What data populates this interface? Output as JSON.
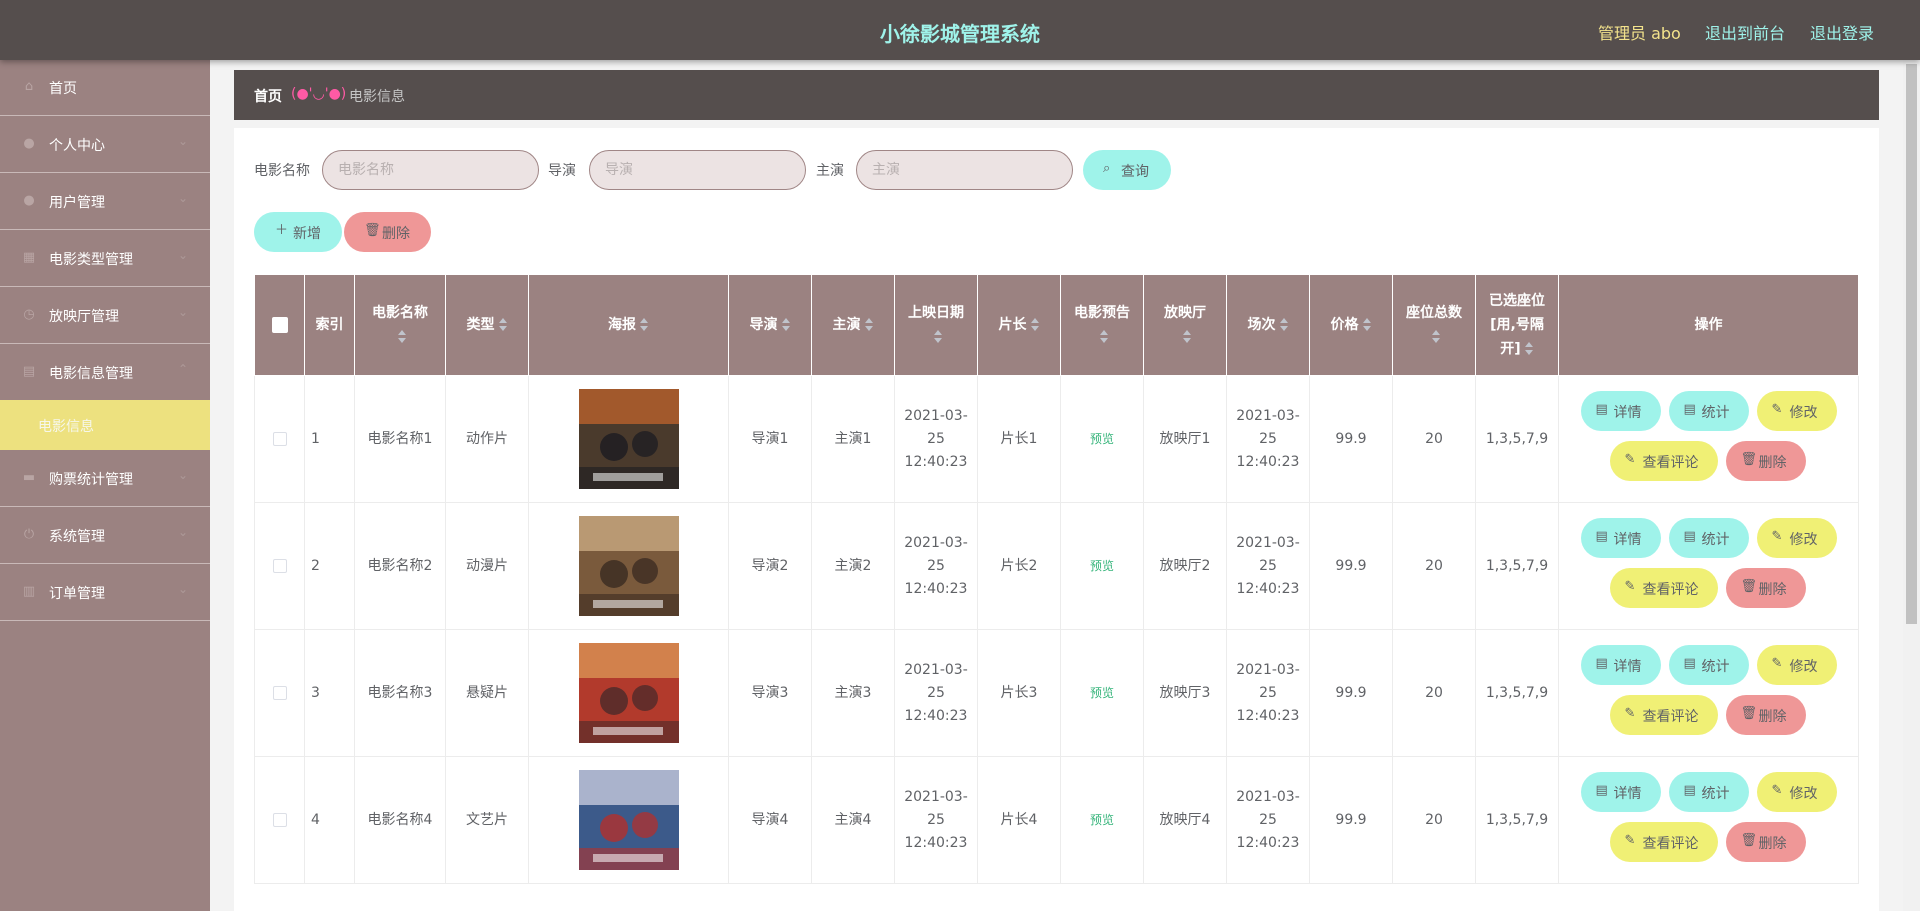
{
  "header": {
    "title": "小徐影城管理系统",
    "user": "管理员 abo",
    "to_front": "退出到前台",
    "logout": "退出登录"
  },
  "sidebar": {
    "items": [
      {
        "label": "首页",
        "icon": "home-icon"
      },
      {
        "label": "个人中心",
        "icon": "user-icon"
      },
      {
        "label": "用户管理",
        "icon": "user-icon"
      },
      {
        "label": "电影类型管理",
        "icon": "grid-icon"
      },
      {
        "label": "放映厅管理",
        "icon": "clock-icon"
      },
      {
        "label": "电影信息管理",
        "icon": "document-icon"
      },
      {
        "label": "购票统计管理",
        "icon": "briefcase-icon"
      },
      {
        "label": "系统管理",
        "icon": "power-icon"
      },
      {
        "label": "订单管理",
        "icon": "bar-chart-icon"
      }
    ],
    "active_sub": "电影信息"
  },
  "breadcrumb": {
    "home": "首页",
    "separator": "(●'◡'●)",
    "current": "电影信息"
  },
  "search": {
    "name_label": "电影名称",
    "name_placeholder": "电影名称",
    "director_label": "导演",
    "director_placeholder": "导演",
    "actor_label": "主演",
    "actor_placeholder": "主演",
    "query_button": "查询"
  },
  "actions": {
    "add": "新增",
    "delete": "删除"
  },
  "table": {
    "columns": [
      "索引",
      "电影名称",
      "类型",
      "海报",
      "导演",
      "主演",
      "上映日期",
      "片长",
      "电影预告",
      "放映厅",
      "场次",
      "价格",
      "座位总数",
      "已选座位[用,号隔开]",
      "操作"
    ],
    "row_buttons": {
      "detail": "详情",
      "stats": "统计",
      "edit": "修改",
      "comments": "查看评论",
      "delete": "删除"
    },
    "rows": [
      {
        "index": "1",
        "name": "电影名称1",
        "type": "动作片",
        "director": "导演1",
        "actor": "主演1",
        "release": "2021-03-25 12:40:23",
        "length": "片长1",
        "trailer": "预览",
        "hall": "放映厅1",
        "session": "2021-03-25 12:40:23",
        "price": "99.9",
        "seats": "20",
        "selected": "1,3,5,7,9"
      },
      {
        "index": "2",
        "name": "电影名称2",
        "type": "动漫片",
        "director": "导演2",
        "actor": "主演2",
        "release": "2021-03-25 12:40:23",
        "length": "片长2",
        "trailer": "预览",
        "hall": "放映厅2",
        "session": "2021-03-25 12:40:23",
        "price": "99.9",
        "seats": "20",
        "selected": "1,3,5,7,9"
      },
      {
        "index": "3",
        "name": "电影名称3",
        "type": "悬疑片",
        "director": "导演3",
        "actor": "主演3",
        "release": "2021-03-25 12:40:23",
        "length": "片长3",
        "trailer": "预览",
        "hall": "放映厅3",
        "session": "2021-03-25 12:40:23",
        "price": "99.9",
        "seats": "20",
        "selected": "1,3,5,7,9"
      },
      {
        "index": "4",
        "name": "电影名称4",
        "type": "文艺片",
        "director": "导演4",
        "actor": "主演4",
        "release": "2021-03-25 12:40:23",
        "length": "片长4",
        "trailer": "预览",
        "hall": "放映厅4",
        "session": "2021-03-25 12:40:23",
        "price": "99.9",
        "seats": "20",
        "selected": "1,3,5,7,9"
      }
    ]
  },
  "colors": {
    "header_bg": "#554e4d",
    "sidebar_bg": "#9b8281",
    "accent_cyan": "#9ff3ea",
    "accent_yellow": "#f0f075",
    "accent_pink": "#ef9797"
  }
}
